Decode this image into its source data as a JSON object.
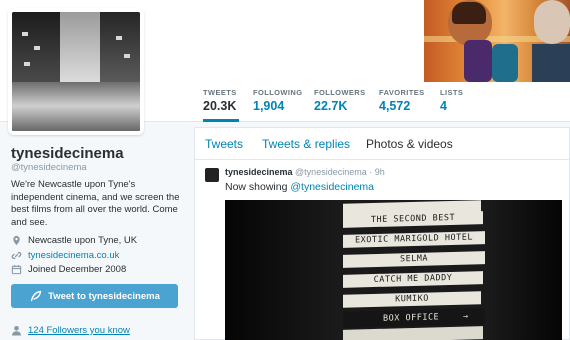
{
  "profile": {
    "name": "tynesidecinema",
    "handle": "@tynesidecinema",
    "bio": "We're Newcastle upon Tyne's independent cinema, and we screen the best films from all over the world. Come and see.",
    "location": "Newcastle upon Tyne, UK",
    "website": "tynesidecinema.co.uk",
    "joined": "Joined December 2008",
    "tweet_to_label": "Tweet to tynesidecinema",
    "followers_you_know": "124 Followers you know"
  },
  "stats": [
    {
      "label": "TWEETS",
      "value": "20.3K"
    },
    {
      "label": "FOLLOWING",
      "value": "1,904"
    },
    {
      "label": "FOLLOWERS",
      "value": "22.7K"
    },
    {
      "label": "FAVORITES",
      "value": "4,572"
    },
    {
      "label": "LISTS",
      "value": "4"
    }
  ],
  "tabs": [
    "Tweets",
    "Tweets & replies",
    "Photos & videos"
  ],
  "tweet": {
    "name": "tynesidecinema",
    "handle": "@tynesidecinema",
    "time": "· 9h",
    "text": "Now showing",
    "mention": "@tynesidecinema",
    "board": [
      "THE SECOND BEST",
      "EXOTIC MARIGOLD HOTEL",
      "SELMA",
      "CATCH ME DADDY",
      "KUMIKO",
      "BOX OFFICE"
    ]
  },
  "colors": {
    "link": "#0084b4",
    "button": "#4ba3d1",
    "background": "#f5f8fa"
  },
  "icons": [
    "location-pin-icon",
    "link-icon",
    "calendar-icon",
    "tweet-feather-icon",
    "person-icon",
    "arrow-right-icon"
  ]
}
